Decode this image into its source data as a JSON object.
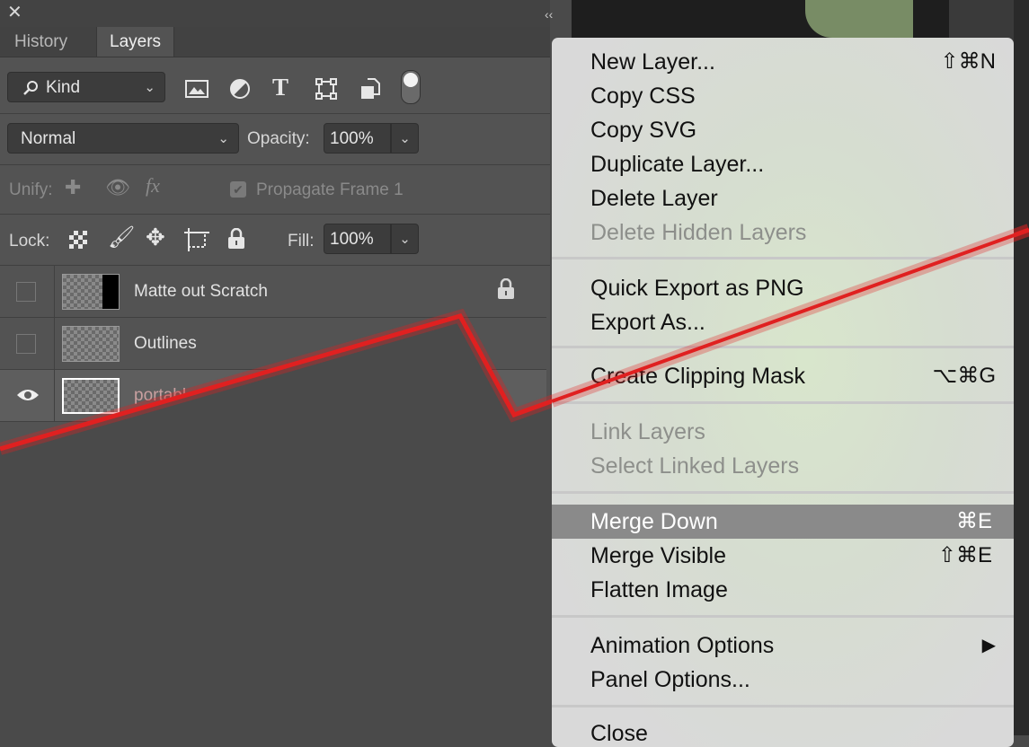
{
  "panel": {
    "tabs": [
      {
        "label": "History"
      },
      {
        "label": "Layers"
      }
    ],
    "filter": {
      "kind_label": "Kind"
    },
    "blend": {
      "mode": "Normal",
      "opacity_label": "Opacity:",
      "opacity_value": "100%"
    },
    "unify": {
      "label": "Unify:",
      "propagate_label": "Propagate Frame 1"
    },
    "lock": {
      "label": "Lock:",
      "fill_label": "Fill:",
      "fill_value": "100%"
    },
    "layers": [
      {
        "name": "Matte out Scratch",
        "locked": true
      },
      {
        "name": "Outlines",
        "locked": false
      },
      {
        "name": "portabl",
        "visible": true
      }
    ]
  },
  "context_menu": {
    "items": [
      {
        "label": "New Layer...",
        "shortcut": "⇧⌘N"
      },
      {
        "label": "Copy CSS",
        "shortcut": ""
      },
      {
        "label": "Copy SVG",
        "shortcut": ""
      },
      {
        "label": "Duplicate Layer...",
        "shortcut": ""
      },
      {
        "label": "Delete Layer",
        "shortcut": ""
      },
      {
        "label": "Delete Hidden Layers",
        "shortcut": "",
        "disabled": true
      },
      {
        "label": "Quick Export as PNG",
        "shortcut": ""
      },
      {
        "label": "Export As...",
        "shortcut": ""
      },
      {
        "label": "Create Clipping Mask",
        "shortcut": "⌥⌘G"
      },
      {
        "label": "Link Layers",
        "shortcut": "",
        "disabled": true
      },
      {
        "label": "Select Linked Layers",
        "shortcut": "",
        "disabled": true
      },
      {
        "label": "Merge Down",
        "shortcut": "⌘E",
        "highlighted": true
      },
      {
        "label": "Merge Visible",
        "shortcut": "⇧⌘E"
      },
      {
        "label": "Flatten Image",
        "shortcut": ""
      },
      {
        "label": "Animation Options",
        "shortcut": "▶"
      },
      {
        "label": "Panel Options...",
        "shortcut": ""
      },
      {
        "label": "Close",
        "shortcut": ""
      }
    ]
  },
  "colors": {
    "annotation_line": "#e02020",
    "highlight": "#8a8a8a"
  }
}
